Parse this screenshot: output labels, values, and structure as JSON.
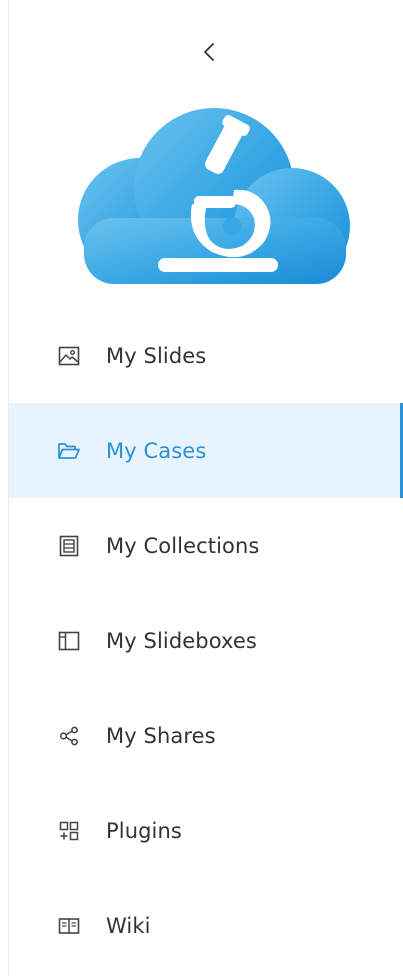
{
  "colors": {
    "accent": "#2a91d8",
    "active_bg": "#e8f4fd",
    "cloud_light": "#5ab8ea",
    "cloud_dark": "#1d8ed8",
    "text": "#333333",
    "icon": "#444444"
  },
  "sidebar": {
    "collapse_icon": "chevron-left-icon",
    "logo_icon": "cloud-microscope-logo",
    "items": [
      {
        "label": "My Slides",
        "icon": "image-icon",
        "active": false
      },
      {
        "label": "My Cases",
        "icon": "folder-open-icon",
        "active": true
      },
      {
        "label": "My Collections",
        "icon": "collection-icon",
        "active": false
      },
      {
        "label": "My Slideboxes",
        "icon": "slidebox-icon",
        "active": false
      },
      {
        "label": "My Shares",
        "icon": "share-icon",
        "active": false
      },
      {
        "label": "Plugins",
        "icon": "plugins-icon",
        "active": false
      },
      {
        "label": "Wiki",
        "icon": "book-icon",
        "active": false
      }
    ]
  }
}
